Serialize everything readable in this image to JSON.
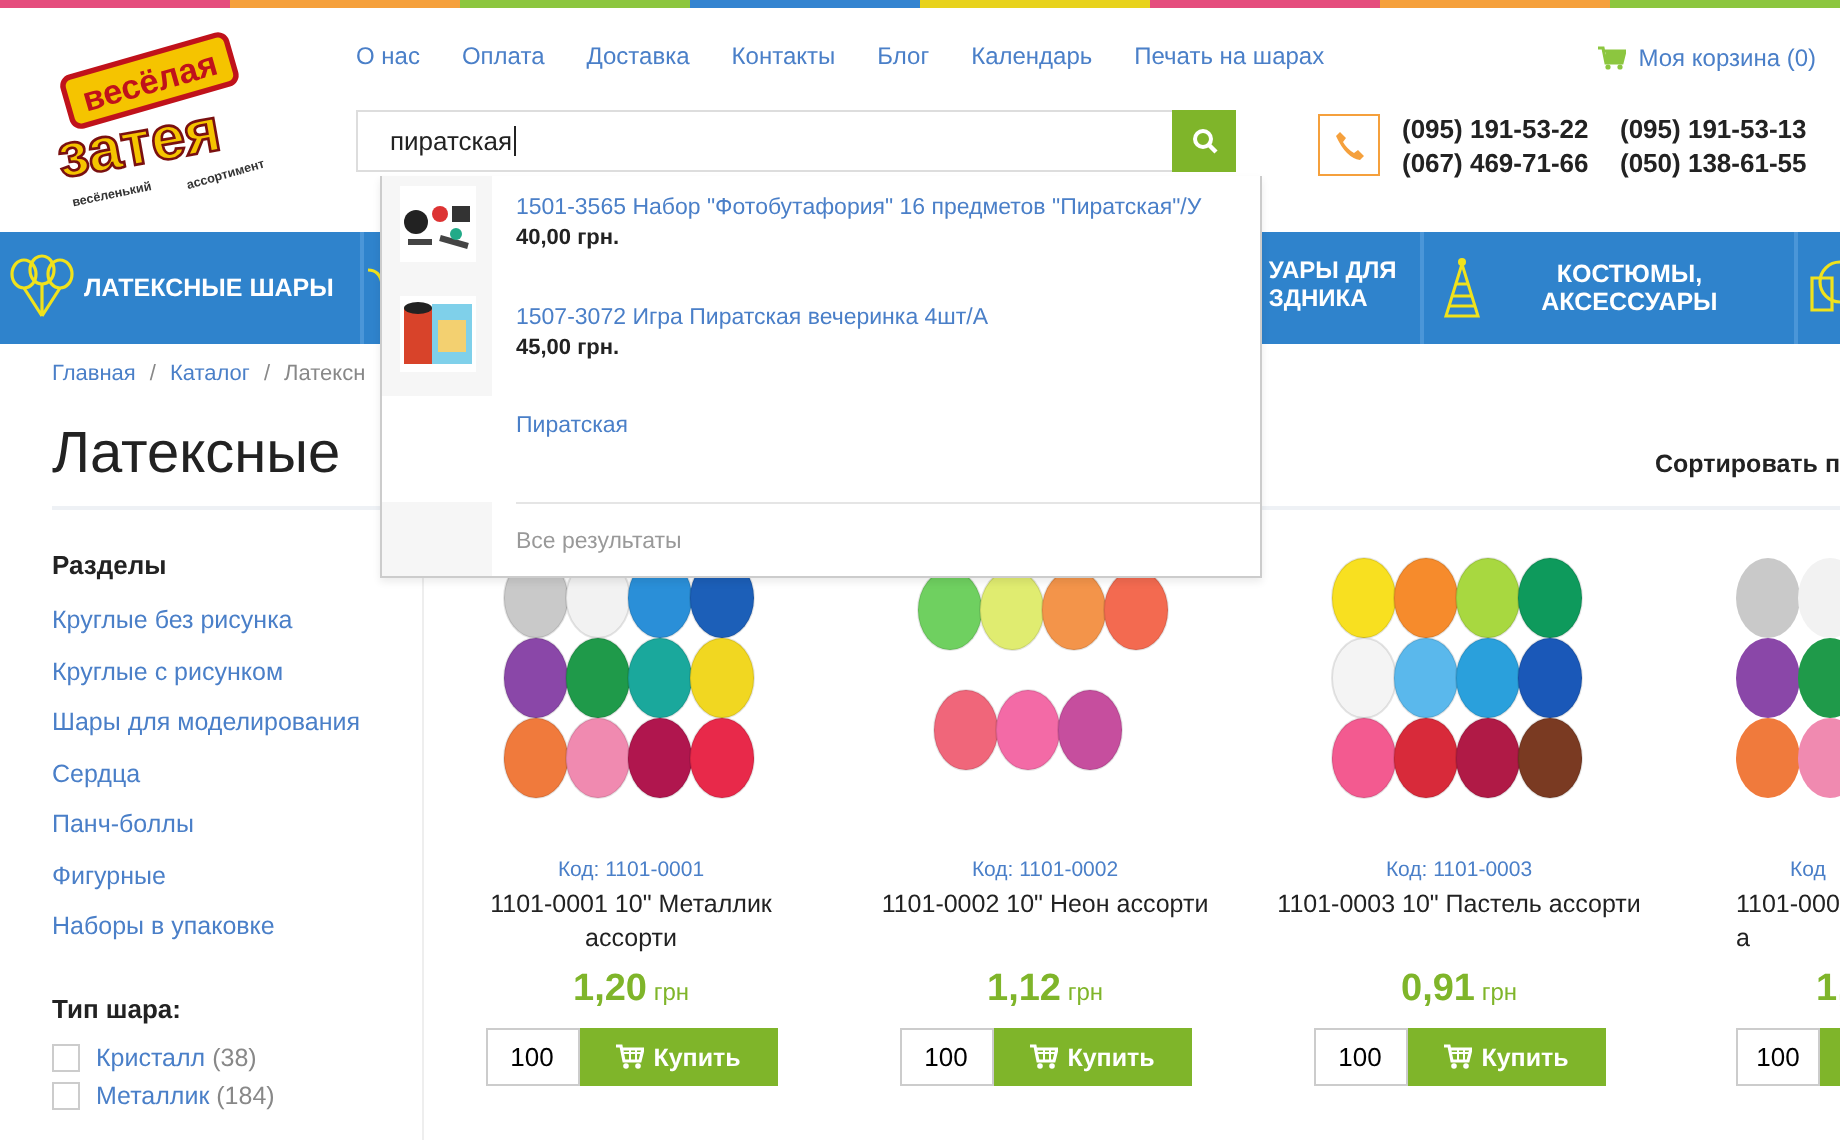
{
  "logo": {
    "line_1": "весёлая",
    "line_2": "затея",
    "tag_1": "весёленький",
    "tag_2": "ассортимент"
  },
  "top_links": [
    "О нас",
    "Оплата",
    "Доставка",
    "Контакты",
    "Блог",
    "Календарь",
    "Печать на шарах"
  ],
  "cart": {
    "label": "Моя корзина (0)"
  },
  "search": {
    "value": "пиратская"
  },
  "phones": [
    "(095) 191-53-22",
    "(095) 191-53-13",
    "(067) 469-71-66",
    "(050) 138-61-55"
  ],
  "categories": [
    {
      "label": "ЛАТЕКСНЫЕ ШАРЫ"
    },
    {
      "label": "УАРЫ ДЛЯ\nЗДНИКА"
    },
    {
      "label": "КОСТЮМЫ,\nАКСЕССУАРЫ"
    }
  ],
  "breadcrumbs": [
    {
      "label": "Главная",
      "separator": "/"
    },
    {
      "label": "Каталог",
      "separator": "/"
    },
    {
      "label": "Латексн"
    }
  ],
  "page_title": "Латексные",
  "sort_label": "Сортировать п",
  "sidebar": {
    "sections_title": "Разделы",
    "sections": [
      "Круглые без рисунка",
      "Круглые с рисунком",
      "Шары для моделирования",
      "Сердца",
      "Панч-боллы",
      "Фигурные",
      "Наборы в упаковке"
    ],
    "filter_title": "Тип шара:",
    "filters": [
      {
        "label": "Кристалл",
        "count": "(38)",
        "checked": false
      },
      {
        "label": "Металлик",
        "count": "(184)",
        "checked": false
      }
    ]
  },
  "products": [
    {
      "code": "Код: 1101-0001",
      "name": "1101-0001 10\" Металлик\nассорти",
      "price": "1,20",
      "currency": "грн",
      "qty": "100",
      "buy": "Купить"
    },
    {
      "code": "Код: 1101-0002",
      "name": "1101-0002 10\" Неон ассорти",
      "price": "1,12",
      "currency": "грн",
      "qty": "100",
      "buy": "Купить"
    },
    {
      "code": "Код: 1101-0003",
      "name": "1101-0003 10\" Пастель ассорти",
      "price": "0,91",
      "currency": "грн",
      "qty": "100",
      "buy": "Купить"
    },
    {
      "code": "Код",
      "name": "1101-000\nа",
      "price": "1,",
      "qty": "100"
    }
  ],
  "search_dropdown": {
    "results": [
      {
        "title": "1501-3565 Набор \"Фотобутафория\" 16 предметов \"Пиратская\"/У",
        "price": "40,00 грн."
      },
      {
        "title": "1507-3072 Игра Пиратская вечеринка 4шт/А",
        "price": "45,00 грн."
      }
    ],
    "suggestion": "Пиратская",
    "all_results": "Все результаты"
  }
}
